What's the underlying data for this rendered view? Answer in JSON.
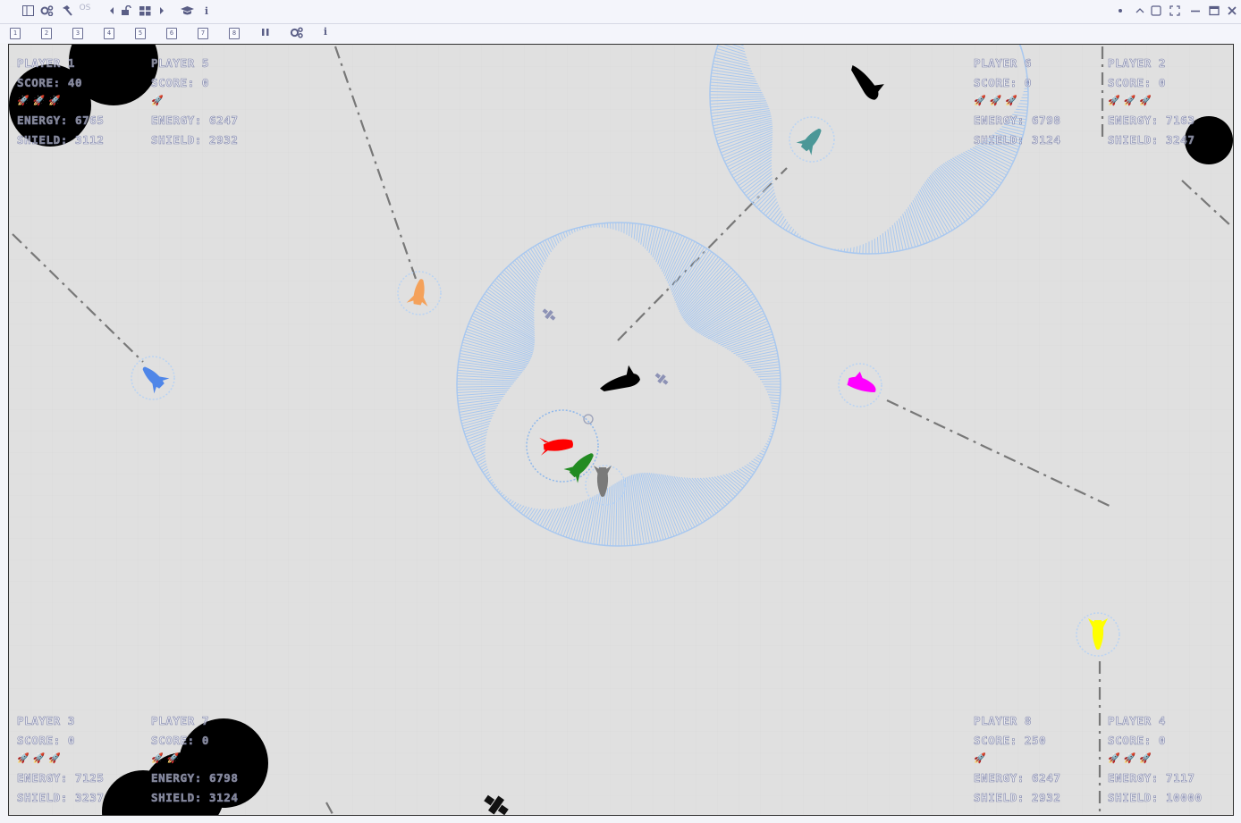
{
  "titlebar": {
    "os_label": "OS",
    "icons_left": [
      "sidebar-toggle-icon",
      "settings-gears-icon",
      "hammer-icon",
      "prev-arrow-icon",
      "unlock-icon",
      "grid-icon",
      "next-arrow-icon",
      "graduation-cap-icon",
      "info-icon"
    ],
    "icons_right": [
      "dot-icon",
      "chevron-up-icon",
      "square-icon",
      "fullscreen-icon",
      "minimize-icon",
      "maximize-icon",
      "close-icon"
    ]
  },
  "toolbar": {
    "slots": [
      "1",
      "2",
      "3",
      "4",
      "5",
      "6",
      "7",
      "8"
    ],
    "pause_icon": "pause-icon",
    "settings_icon": "settings-gears-icon",
    "info_label": "i"
  },
  "colors": {
    "background": "#e0e0e0",
    "hud_outline": "#7d83ab",
    "shield_ring": "#a9c8ef",
    "player_1": "#ff0000",
    "player_2": "#4b9797",
    "player_3": "#4f86e8",
    "player_4": "#ffff00",
    "player_5": "#f4a15a",
    "player_6": "#000000",
    "player_7": "#ff00ff",
    "player_8": "#228b22"
  },
  "hud": {
    "p1": {
      "name": "PLAYER 1",
      "score": "SCORE: 40",
      "lives": "🚀🚀🚀",
      "energy": "ENERGY: 6765",
      "shield": "SHIELD: 3112"
    },
    "p5": {
      "name": "PLAYER 5",
      "score": "SCORE: 0",
      "lives": "🚀",
      "energy": "ENERGY: 6247",
      "shield": "SHIELD: 2932"
    },
    "p6": {
      "name": "PLAYER 6",
      "score": "SCORE: 0",
      "lives": "🚀🚀🚀",
      "energy": "ENERGY: 6798",
      "shield": "SHIELD: 3124"
    },
    "p2": {
      "name": "PLAYER 2",
      "score": "SCORE: 0",
      "lives": "🚀🚀🚀",
      "energy": "ENERGY: 7163",
      "shield": "SHIELD: 3247"
    },
    "p3": {
      "name": "PLAYER 3",
      "score": "SCORE: 0",
      "lives": "🚀🚀🚀",
      "energy": "ENERGY: 7125",
      "shield": "SHIELD: 3237"
    },
    "p7": {
      "name": "PLAYER 7",
      "score": "SCORE: 0",
      "lives": "🚀🚀",
      "energy": "ENERGY: 6798",
      "shield": "SHIELD: 3124"
    },
    "p8": {
      "name": "PLAYER 8",
      "score": "SCORE: 250",
      "lives": "🚀",
      "energy": "ENERGY: 6247",
      "shield": "SHIELD: 2932"
    },
    "p4": {
      "name": "PLAYER 4",
      "score": "SCORE: 0",
      "lives": "🚀🚀🚀",
      "energy": "ENERGY: 7117",
      "shield": "SHIELD: 10000"
    }
  }
}
